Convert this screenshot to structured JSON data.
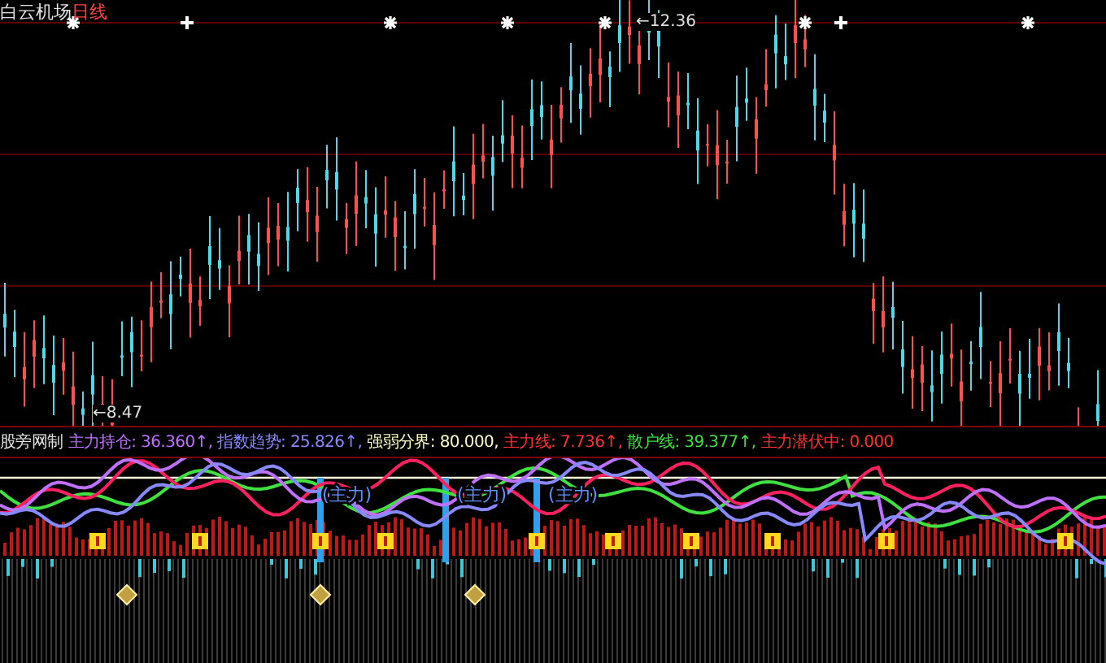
{
  "header": {
    "stock": "白云机场",
    "period": "日线"
  },
  "price_labels": {
    "high": "←12.36",
    "low": "←8.47"
  },
  "indicator": {
    "title": "股旁网制",
    "legend": [
      {
        "label": "主力持仓: 36.360↑,",
        "color": "#c070ff"
      },
      {
        "label": "指数趋势: 25.826↑,",
        "color": "#8888ff"
      },
      {
        "label": "强弱分界: 80.000,",
        "color": "#ffffc8"
      },
      {
        "label": "主力线: 7.736↑,",
        "color": "#ff3030"
      },
      {
        "label": "散户线: 39.377↑,",
        "color": "#40e040"
      },
      {
        "label": "主力潜伏中: 0.000",
        "color": "#ff3030"
      }
    ],
    "zone_labels": [
      "(主力)",
      "(主力)",
      "(主力)"
    ]
  }
}
